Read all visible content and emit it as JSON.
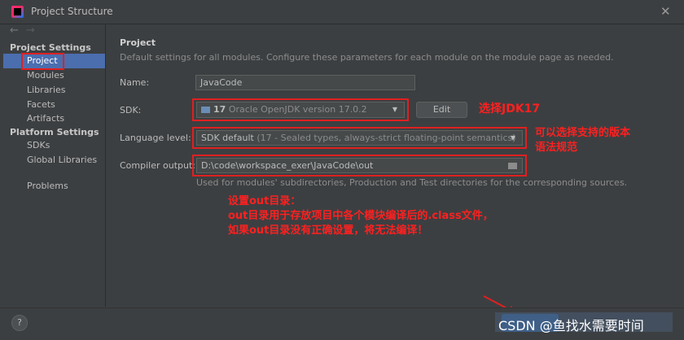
{
  "window": {
    "title": "Project Structure",
    "close": "✕"
  },
  "nav": {
    "back": "←",
    "forward": "→"
  },
  "sidebar": {
    "project_settings": "Project Settings",
    "items_project": [
      "Project",
      "Modules",
      "Libraries",
      "Facets",
      "Artifacts"
    ],
    "platform_settings": "Platform Settings",
    "items_platform": [
      "SDKs",
      "Global Libraries"
    ],
    "problems": "Problems"
  },
  "main": {
    "heading": "Project",
    "description": "Default settings for all modules. Configure these parameters for each module on the module page as needed.",
    "name_label": "Name:",
    "name_value": "JavaCode",
    "sdk_label": "SDK:",
    "sdk_value_bold": "17",
    "sdk_value_rest": "Oracle OpenJDK version 17.0.2",
    "edit_button": "Edit",
    "language_label": "Language level:",
    "language_value_bold": "SDK default",
    "language_value_rest": "(17 - Sealed types, always-strict floating-point semantics)",
    "compiler_label": "Compiler output:",
    "compiler_value": "D:\\code\\workspace_exer\\JavaCode\\out",
    "compiler_hint": "Used for modules' subdirectories, Production and Test directories for the corresponding sources."
  },
  "annotations": {
    "sdk": "选择JDK17",
    "language_line1": "可以选择支持的版本",
    "language_line2": "语法规范",
    "out_line1": "设置out目录：",
    "out_line2": "out目录用于存放项目中各个模块编译后的.class文件，",
    "out_line3": "如果out目录没有正确设置，将无法编译！"
  },
  "footer": {
    "help": "?",
    "watermark": "CSDN @鱼找水需要时间"
  },
  "colors": {
    "annotation_red": "#e02020",
    "selection_blue": "#4b6eaf",
    "background": "#3c3f41"
  }
}
